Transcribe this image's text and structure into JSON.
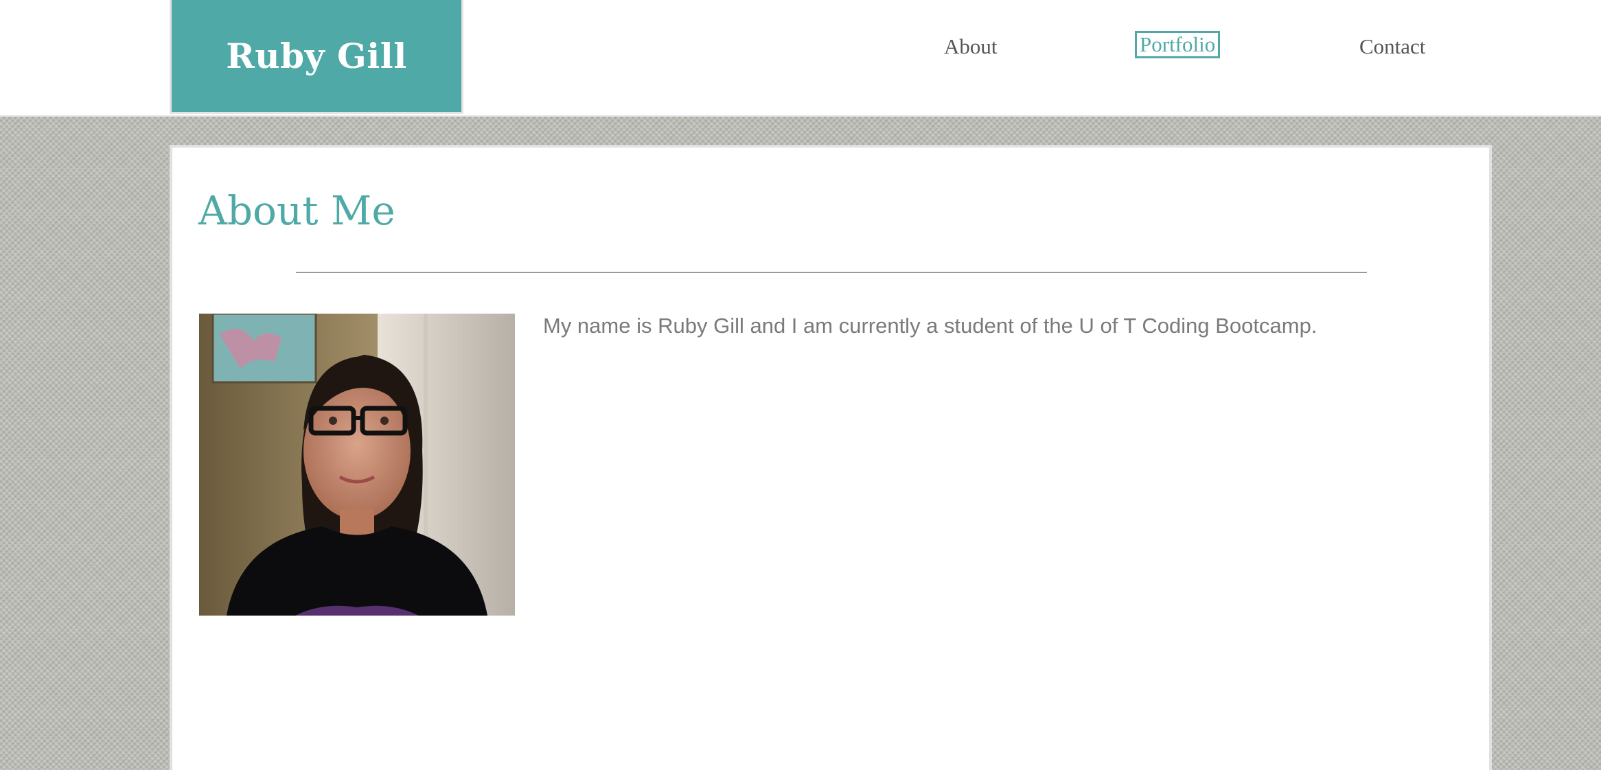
{
  "header": {
    "logo_text": "Ruby Gill",
    "nav": {
      "about": "About",
      "portfolio": "Portfolio",
      "contact": "Contact"
    }
  },
  "about": {
    "title": "About Me",
    "photo_alt": "Portrait of Ruby Gill",
    "bio": "My name is Ruby Gill and I am currently a student of the U of T Coding Bootcamp."
  },
  "colors": {
    "accent": "#4fa9a6",
    "text": "#555555",
    "body_text": "#7a7a7a",
    "background_texture": "#b9bab4"
  }
}
